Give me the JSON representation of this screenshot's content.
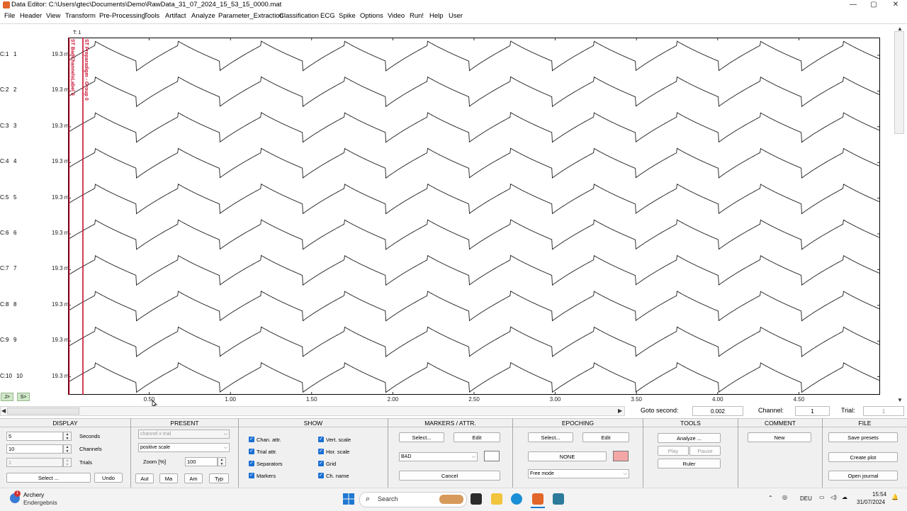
{
  "window": {
    "title": "Data Editor: C:\\Users\\gtec\\Documents\\Demo\\RawData_31_07_2024_15_53_15_0000.mat",
    "controls": [
      "—",
      "▢",
      "✕"
    ]
  },
  "menu": [
    "File",
    "Header",
    "View",
    "Transform",
    "Pre-Processing",
    "Tools",
    "Artifact",
    "Analyze",
    "Parameter_Extraction",
    "Classification",
    "ECG",
    "Spike",
    "Options",
    "Video",
    "Run!",
    "Help",
    "User"
  ],
  "plot": {
    "trial_label": "T: 1",
    "channels": [
      {
        "label": "C:1",
        "num": "1",
        "scale": "19.3 m"
      },
      {
        "label": "C:2",
        "num": "2",
        "scale": "19.3 m"
      },
      {
        "label": "C:3",
        "num": "3",
        "scale": "19.3 m"
      },
      {
        "label": "C:4",
        "num": "4",
        "scale": "19.3 m"
      },
      {
        "label": "C:5",
        "num": "5",
        "scale": "19.3 m"
      },
      {
        "label": "C:6",
        "num": "6",
        "scale": "19.3 m"
      },
      {
        "label": "C:7",
        "num": "7",
        "scale": "19.3 m"
      },
      {
        "label": "C:8",
        "num": "8",
        "scale": "19.3 m"
      },
      {
        "label": "C:9",
        "num": "9",
        "scale": "19.3 m"
      },
      {
        "label": "C:10",
        "num": "10",
        "scale": "19.3 m"
      }
    ],
    "x_ticks": [
      "0.50",
      "1.00",
      "1.50",
      "2.00",
      "2.50",
      "3.00",
      "3.50",
      "4.00",
      "4.50"
    ],
    "x_range": [
      0,
      5
    ],
    "marker_texts": [
      "ST BadChannelsLabel 0",
      "ST Preparadigm - Group 0"
    ],
    "marker_color": "#c8102e"
  },
  "nav": {
    "prev": "J>",
    "next": "S>"
  },
  "goto": {
    "label": "Goto second:",
    "value": "0.002",
    "channel_label": "Channel:",
    "channel_value": "1",
    "trial_label": "Trial:",
    "trial_value": "1"
  },
  "panels": {
    "display": {
      "title": "DISPLAY",
      "seconds_value": "5",
      "seconds_label": "Seconds",
      "channels_value": "10",
      "channels_label": "Channels",
      "trials_value": "1",
      "trials_label": "Trials",
      "select_label": "Select ...",
      "undo_label": "Undo"
    },
    "present": {
      "title": "PRESENT",
      "mode": "channel x trial",
      "scale": "positive scale",
      "zoom_label": "Zoom [%]",
      "zoom_value": "100",
      "buttons": [
        "Aut",
        "Ma",
        "Am",
        "Typ"
      ]
    },
    "show": {
      "title": "SHOW",
      "left": [
        "Chan. attr.",
        "Trial attr.",
        "Separators",
        "Markers"
      ],
      "right": [
        "Vert. scale",
        "Hor. scale",
        "Grid",
        "Ch. name"
      ]
    },
    "markers": {
      "title": "MARKERS / ATTR.",
      "select_label": "Select...",
      "edit_label": "Edit",
      "attr_value": "BAD",
      "cancel_label": "Cancel",
      "swatch_color": "#ffffff"
    },
    "epoching": {
      "title": "EPOCHING",
      "select_label": "Select...",
      "edit_label": "Edit",
      "none_label": "NONE",
      "mode": "Free mode",
      "swatch_color": "#f4a7a7"
    },
    "tools": {
      "title": "TOOLS",
      "analyze_label": "Analyze ...",
      "play_label": "Play",
      "pause_label": "Pause",
      "ruler_label": "Ruler"
    },
    "comment": {
      "title": "COMMENT",
      "new_label": "New"
    },
    "file": {
      "title": "FILE",
      "save_label": "Save presets",
      "create_label": "Create plot",
      "open_label": "Open journal"
    }
  },
  "taskbar": {
    "weather_title": "Archery",
    "weather_sub": "Endergebnis",
    "badge": "1",
    "search_placeholder": "Search",
    "lang": "DEU",
    "time": "15:54",
    "date": "31/07/2024"
  }
}
